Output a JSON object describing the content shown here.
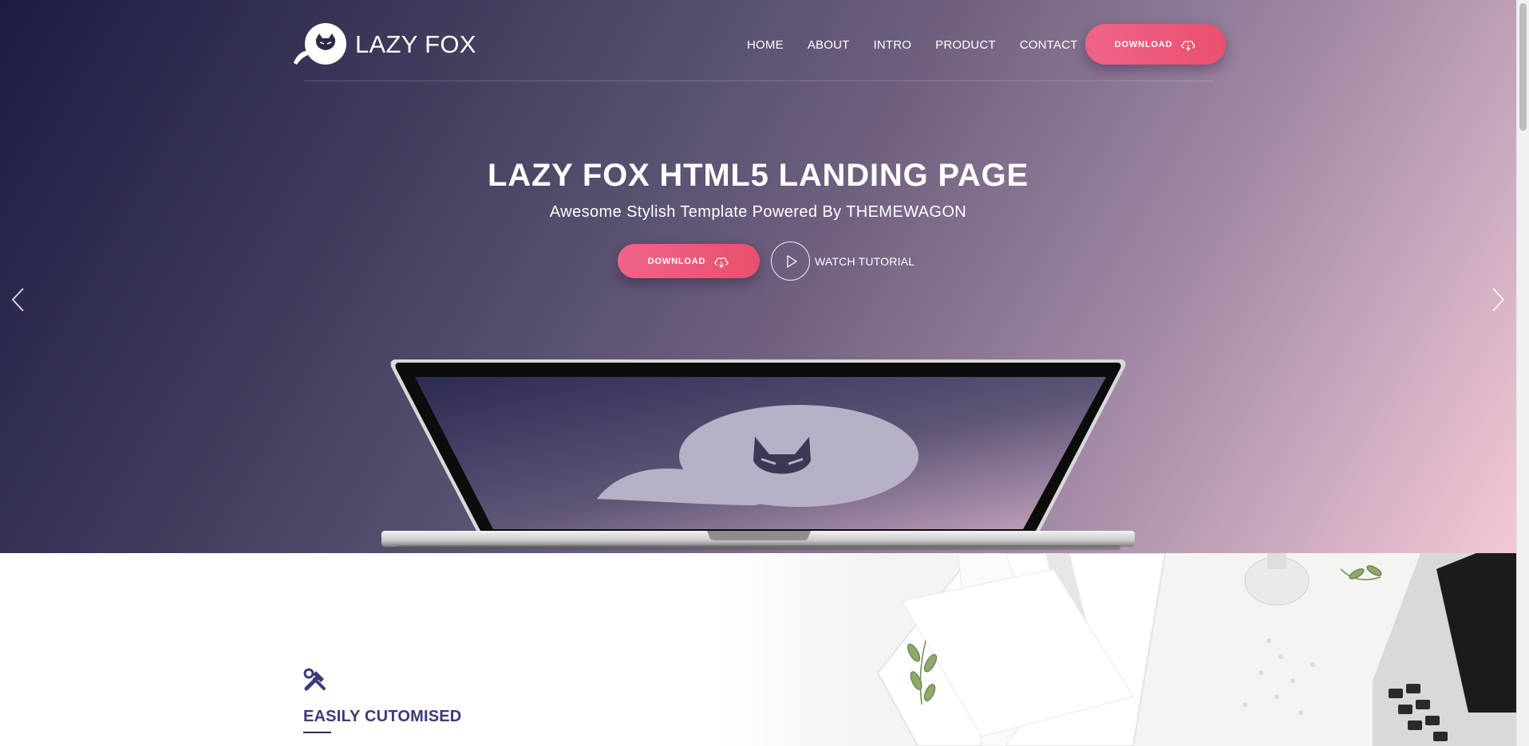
{
  "brand": {
    "name": "LAZY FOX"
  },
  "nav": {
    "items": [
      "HOME",
      "ABOUT",
      "INTRO",
      "PRODUCT",
      "CONTACT"
    ],
    "download_label": "DOWNLOAD"
  },
  "hero": {
    "title": "LAZY FOX HTML5 LANDING PAGE",
    "subtitle": "Awesome Stylish Template Powered By THEMEWAGON",
    "download_label": "DOWNLOAD",
    "watch_label": "WATCH TUTORIAL"
  },
  "features": {
    "title": "EASILY CUTOMISED",
    "icon": "tools-icon"
  },
  "colors": {
    "accent": "#ec5a7c",
    "heading": "#3b3a7a",
    "hero_dark": "#1c1c42",
    "hero_light": "#f3c9d7"
  },
  "icons": [
    "fox-logo-icon",
    "cloud-download-icon",
    "play-icon",
    "chevron-left-icon",
    "chevron-right-icon",
    "tools-icon"
  ]
}
